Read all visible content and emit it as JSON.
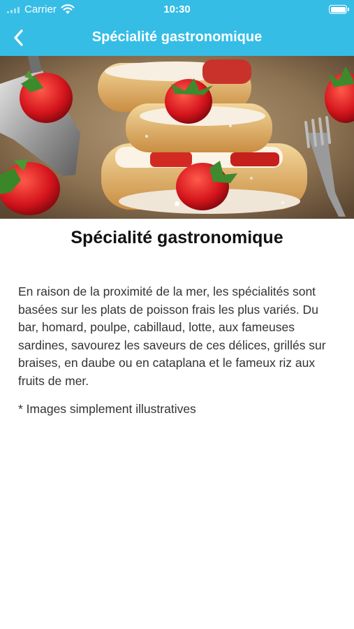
{
  "status_bar": {
    "carrier": "Carrier",
    "time": "10:30"
  },
  "nav": {
    "title": "Spécialité gastronomique",
    "back_icon": "chevron-left-icon"
  },
  "hero": {
    "slide_count": 1,
    "active_slide": 1
  },
  "content": {
    "title": "Spécialité gastronomique",
    "body": "En raison de la proximité de la mer, les spécialités sont basées sur les plats de poisson frais les plus variés. Du bar, homard, poulpe, cabillaud, lotte, aux fameuses sardines, savourez les saveurs de ces délices, grillés sur braises, en daube ou en cataplana et le fameux riz aux fruits de mer.",
    "disclaimer": "* Images simplement illustratives"
  },
  "colors": {
    "header": "#35bde6",
    "text": "#333333",
    "title": "#111111"
  }
}
